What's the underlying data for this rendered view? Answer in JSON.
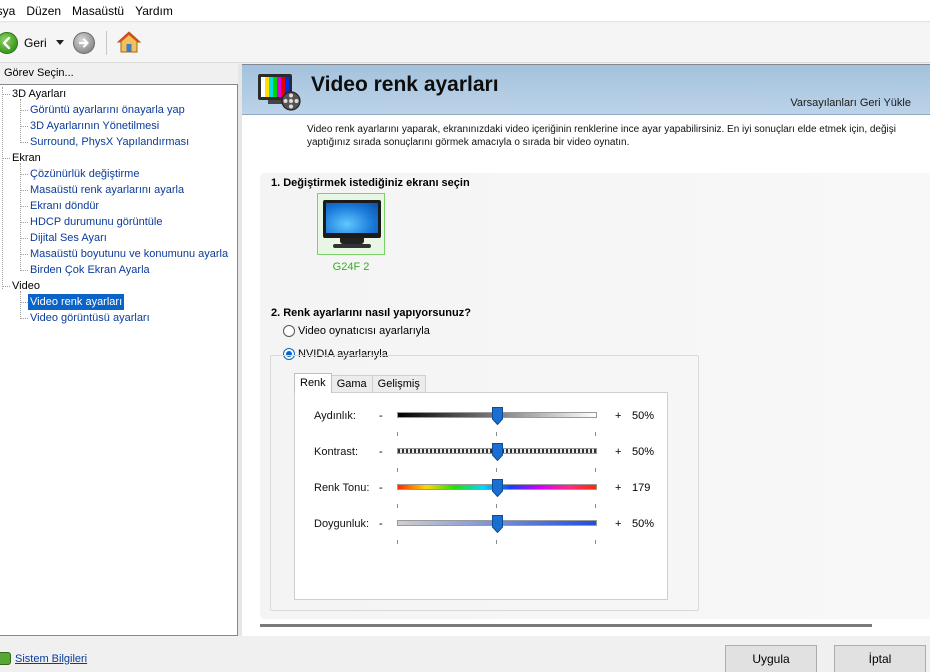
{
  "menu": [
    "osya",
    "Düzen",
    "Masaüstü",
    "Yardım"
  ],
  "toolbar": {
    "back_label": "Geri"
  },
  "left": {
    "header": "Görev Seçin...",
    "categories": [
      {
        "label": "3D Ayarları",
        "items": [
          "Görüntü ayarlarını önayarla yap",
          "3D Ayarlarının Yönetilmesi",
          "Surround, PhysX Yapılandırması"
        ]
      },
      {
        "label": "Ekran",
        "items": [
          "Çözünürlük değiştirme",
          "Masaüstü renk ayarlarını ayarla",
          "Ekranı döndür",
          "HDCP durumunu görüntüle",
          "Dijital Ses Ayarı",
          "Masaüstü boyutunu ve konumunu ayarla",
          "Birden Çok Ekran Ayarla"
        ]
      },
      {
        "label": "Video",
        "items": [
          "Video renk ayarları",
          "Video görüntüsü ayarları"
        ]
      }
    ],
    "selected": "Video renk ayarları"
  },
  "page": {
    "title": "Video renk ayarları",
    "restore_defaults": "Varsayılanları Geri Yükle",
    "description": "Video renk ayarlarını yaparak, ekranınızdaki video içeriğinin renklerine ince ayar yapabilirsiniz. En iyi sonuçları elde etmek için, değişi yaptığınız sırada sonuçlarını görmek amacıyla o sırada bir video oynatın.",
    "step1_title": "1. Değiştirmek istediğiniz ekranı seçin",
    "display_name": "G24F 2",
    "step2_title": "2. Renk ayarlarını nasıl yapıyorsunuz?",
    "option_player": "Video oynatıcısı ayarlarıyla",
    "option_nvidia": "NVIDIA ayarlarıyla",
    "tabs": [
      "Renk",
      "Gama",
      "Gelişmiş"
    ],
    "active_tab": "Renk",
    "sliders": [
      {
        "label": "Aydınlık:",
        "minus": "-",
        "plus": "+",
        "value": "50%",
        "level": 0.5
      },
      {
        "label": "Kontrast:",
        "minus": "-",
        "plus": "+",
        "value": "50%",
        "level": 0.5
      },
      {
        "label": "Renk Tonu:",
        "minus": "-",
        "plus": "+",
        "value": "179",
        "level": 0.5
      },
      {
        "label": "Doygunluk:",
        "minus": "-",
        "plus": "+",
        "value": "50%",
        "level": 0.5
      }
    ]
  },
  "bottom": {
    "system_info": "Sistem Bilgileri",
    "apply": "Uygula",
    "cancel": "İptal"
  },
  "colors": {
    "link": "#0b3b9a",
    "selected": "#0a64c8",
    "banner": "#a4c2dd",
    "display_green": "#3aaa2a",
    "thumb": "#1a6fd0"
  }
}
